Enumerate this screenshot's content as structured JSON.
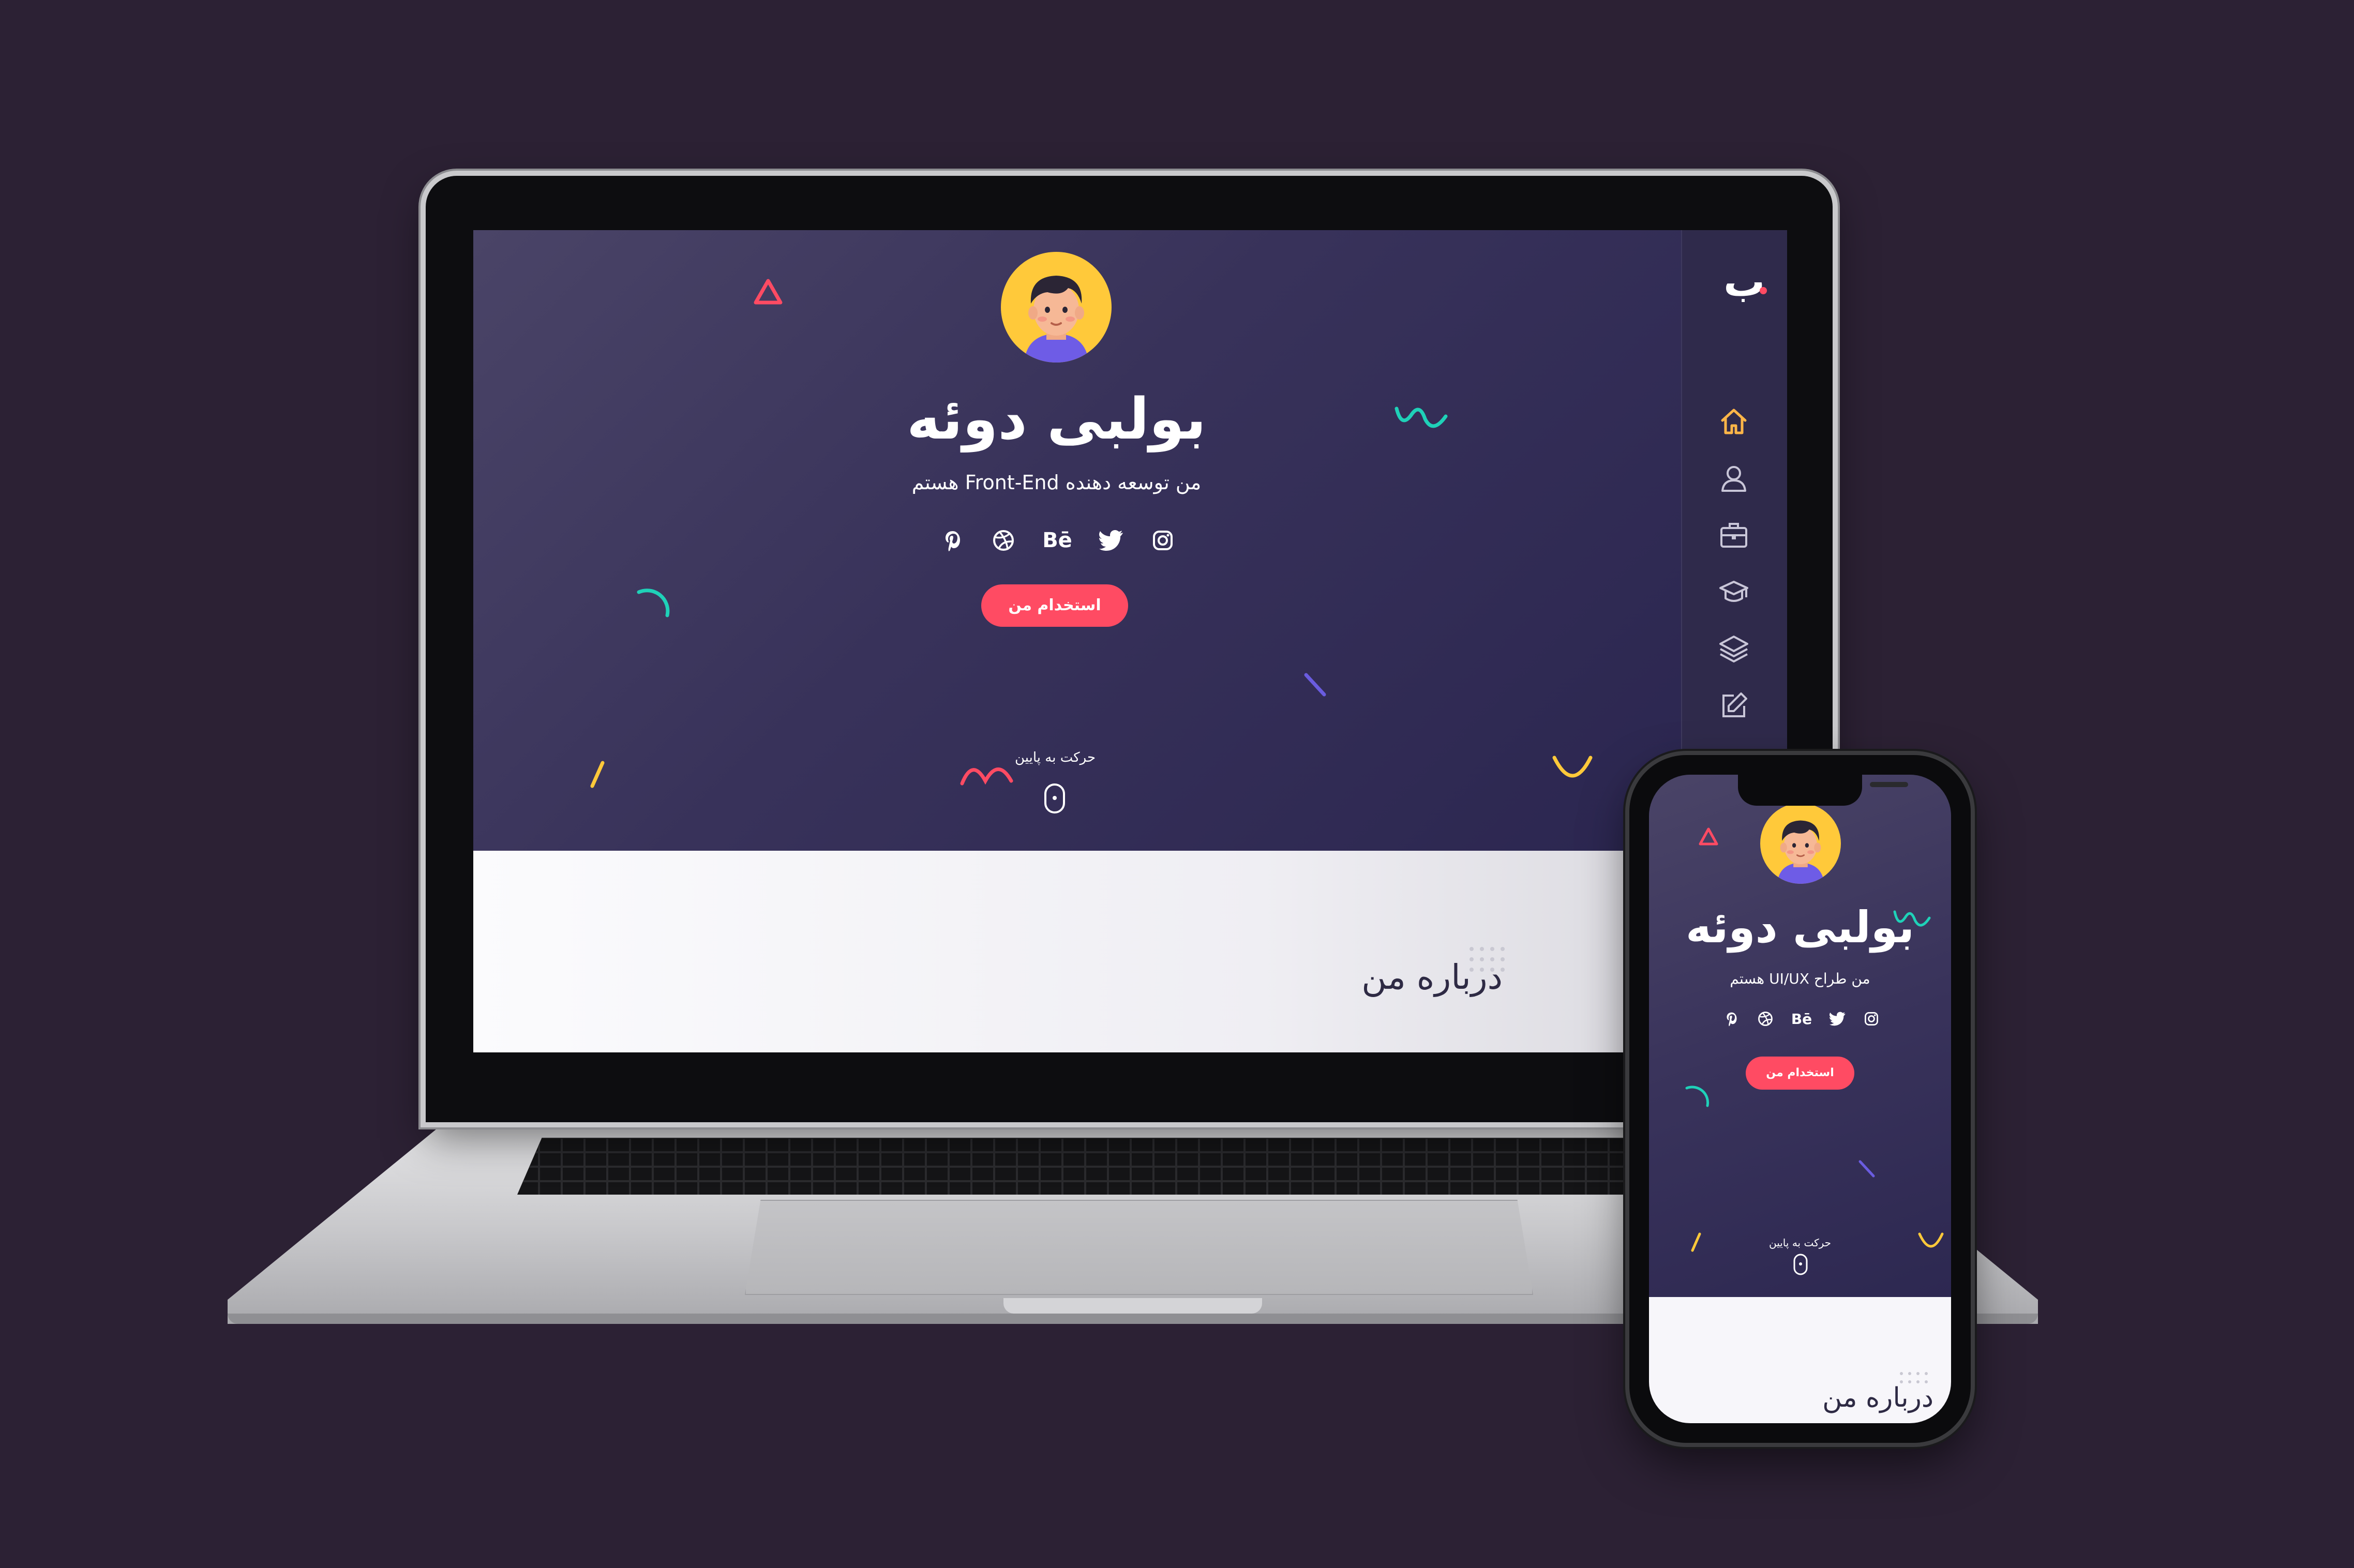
{
  "colors": {
    "background": "#2c2134",
    "hero": "#38325a",
    "accent_button": "#ff4b63",
    "avatar_bg": "#ffc93a",
    "home_icon_active": "#ffb648",
    "sidebar_icon": "#c9c6d8"
  },
  "desktop": {
    "logo": "ب",
    "name": "بولبی دوئه",
    "subtitle": "من توسعه دهنده Front-End هستم",
    "hire_button": "استخدام من",
    "scroll_label": "حرکت به پایین",
    "about_title": "درباره من",
    "social_icons": [
      "instagram-icon",
      "twitter-icon",
      "behance-icon",
      "dribbble-icon",
      "pinterest-icon"
    ],
    "behance_text": "Bē",
    "sidebar_icons": [
      "home-icon",
      "user-icon",
      "briefcase-icon",
      "graduation-cap-icon",
      "layers-icon",
      "edit-icon"
    ]
  },
  "mobile": {
    "name": "بولبی دوئه",
    "subtitle": "من طراح UI/UX هستم",
    "hire_button": "استخدام من",
    "scroll_label": "حرکت به پایین",
    "about_title": "درباره من",
    "behance_text": "Bē"
  }
}
